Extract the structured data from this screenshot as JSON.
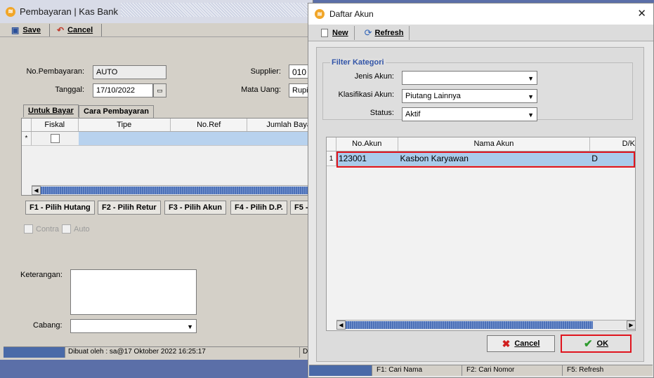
{
  "main_window": {
    "title": "Pembayaran | Kas Bank",
    "toolbar": {
      "save_label": "Save",
      "cancel_label": "Cancel"
    },
    "form": {
      "no_pembayaran_label": "No.Pembayaran:",
      "no_pembayaran_value": "AUTO",
      "tanggal_label": "Tanggal:",
      "tanggal_value": "17/10/2022",
      "supplier_label": "Supplier:",
      "supplier_value": "010",
      "mata_uang_label": "Mata Uang:",
      "mata_uang_value": "Rupi"
    },
    "tabs": [
      "Untuk Bayar",
      "Cara Pembayaran"
    ],
    "grid": {
      "columns": [
        "Fiskal",
        "Tipe",
        "No.Ref",
        "Jumlah Baya"
      ],
      "new_row_marker": "*"
    },
    "function_buttons": [
      "F1 - Pilih Hutang",
      "F2 - Pilih Retur",
      "F3 - Pilih Akun",
      "F4 - Pilih D.P.",
      "F5 -"
    ],
    "checkboxes": {
      "contra_label": "Contra",
      "auto_label": "Auto"
    },
    "keterangan_label": "Keterangan:",
    "cabang_label": "Cabang:",
    "status": {
      "created_by": "Dibuat oleh : sa@17 Oktober 2022  16:25:17",
      "tail": "Di"
    }
  },
  "dialog": {
    "title": "Daftar Akun",
    "toolbar": {
      "new_label": "New",
      "refresh_label": "Refresh"
    },
    "filter": {
      "legend": "Filter Kategori",
      "jenis_akun_label": "Jenis Akun:",
      "jenis_akun_value": "",
      "klasifikasi_akun_label": "Klasifikasi Akun:",
      "klasifikasi_akun_value": "Piutang Lainnya",
      "status_label": "Status:",
      "status_value": "Aktif"
    },
    "table": {
      "columns": [
        "No.Akun",
        "Nama Akun",
        "D/K"
      ],
      "rows": [
        {
          "index": "1",
          "no_akun": "123001",
          "nama_akun": "Kasbon Karyawan",
          "dk": "D"
        }
      ]
    },
    "buttons": {
      "cancel_label": "Cancel",
      "ok_label": "OK"
    },
    "status": {
      "f1": "F1: Cari Nama",
      "f2": "F2: Cari Nomor",
      "f5": "F5: Refresh"
    }
  },
  "colors": {
    "highlight": "#e0141e",
    "selection": "#a9cbeb",
    "accent": "#3355a8"
  }
}
